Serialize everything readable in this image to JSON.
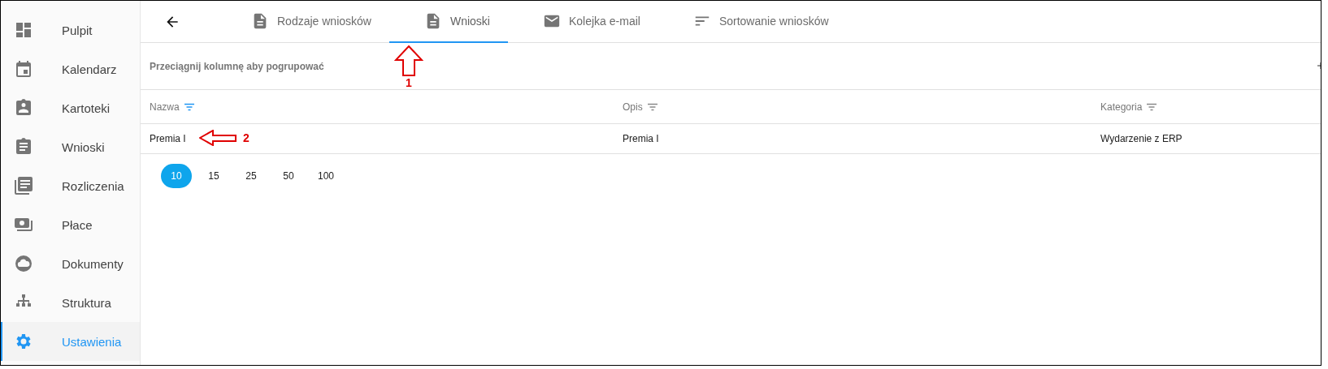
{
  "sidebar": {
    "items": [
      {
        "label": "Pulpit",
        "selected": false
      },
      {
        "label": "Kalendarz",
        "selected": false
      },
      {
        "label": "Kartoteki",
        "selected": false
      },
      {
        "label": "Wnioski",
        "selected": false
      },
      {
        "label": "Rozliczenia",
        "selected": false
      },
      {
        "label": "Płace",
        "selected": false
      },
      {
        "label": "Dokumenty",
        "selected": false
      },
      {
        "label": "Struktura",
        "selected": false
      },
      {
        "label": "Ustawienia",
        "selected": true
      }
    ]
  },
  "tabs": [
    {
      "label": "Rodzaje wniosków",
      "selected": false
    },
    {
      "label": "Wnioski",
      "selected": true
    },
    {
      "label": "Kolejka e-mail",
      "selected": false
    },
    {
      "label": "Sortowanie wniosków",
      "selected": false
    }
  ],
  "group_bar": {
    "text": "Przeciągnij kolumnę aby pogrupować"
  },
  "table": {
    "columns": [
      {
        "label": "Nazwa",
        "filter_active": true
      },
      {
        "label": "Opis",
        "filter_active": false
      },
      {
        "label": "Kategoria",
        "filter_active": false
      }
    ],
    "rows": [
      [
        "Premia I",
        "Premia I",
        "Wydarzenie z ERP"
      ]
    ]
  },
  "page_sizes": [
    {
      "label": "10",
      "selected": true
    },
    {
      "label": "15",
      "selected": false
    },
    {
      "label": "25",
      "selected": false
    },
    {
      "label": "50",
      "selected": false
    },
    {
      "label": "100",
      "selected": false
    }
  ],
  "annotations": [
    {
      "kind": "arrow_up",
      "label": "1"
    },
    {
      "kind": "arrow_left",
      "label": "2"
    }
  ]
}
